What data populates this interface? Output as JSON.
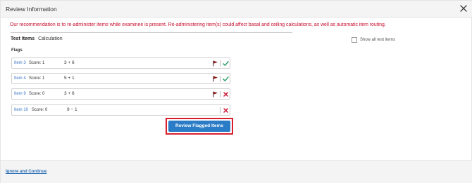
{
  "dialog": {
    "title": "Review Information",
    "warning": "Our recommendation is to re-administer items while examinee is present. Re-administering item(s) could affect basal and ceiling calculations, as well as automatic item routing."
  },
  "tabs": {
    "active": "Test Items",
    "other": "Calculation"
  },
  "show_all_label": "Show all test items",
  "flags_heading": "Flags",
  "items": [
    {
      "link": "Item 3",
      "score": "Score: 1",
      "expression": "3 + 6",
      "flagged": true,
      "result": "correct"
    },
    {
      "link": "Item 4",
      "score": "Score: 1",
      "expression": "5 + 1",
      "flagged": true,
      "result": "correct"
    },
    {
      "link": "Item 9",
      "score": "Score: 0",
      "expression": "3 + 6",
      "flagged": true,
      "result": "incorrect"
    },
    {
      "link": "Item 10",
      "score": "Score: 0",
      "expression": "9 − 1",
      "flagged": false,
      "result": "incorrect"
    }
  ],
  "review_button": "Review Flagged Items",
  "footer_link": "Ignore and Continue",
  "colors": {
    "warning": "#c8102e",
    "link": "#3a76c4",
    "primary": "#2a7cc7",
    "highlight": "#d7202e",
    "flag": "#8b1a1a",
    "check": "#2e9e6b",
    "cross": "#c8102e"
  }
}
